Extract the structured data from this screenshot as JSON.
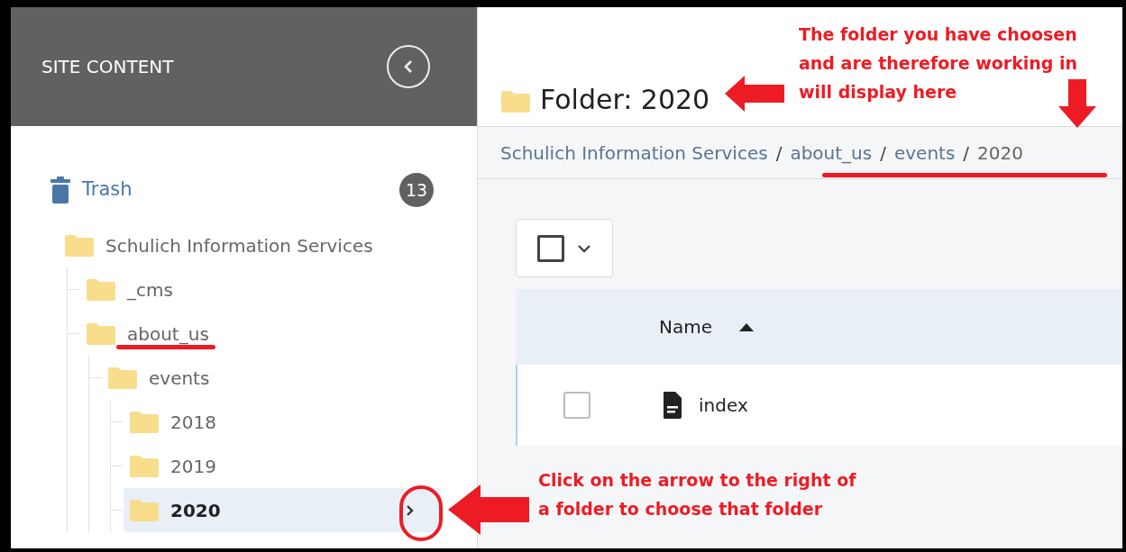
{
  "sidebar": {
    "title": "SITE CONTENT",
    "trash": {
      "label": "Trash",
      "count": "13"
    },
    "tree": [
      {
        "name": "Schulich Information Services",
        "selected": false,
        "children": [
          {
            "name": "_cms",
            "selected": false
          },
          {
            "name": "about_us",
            "selected": false,
            "children": [
              {
                "name": "events",
                "selected": false,
                "children": [
                  {
                    "name": "2018",
                    "selected": false
                  },
                  {
                    "name": "2019",
                    "selected": false
                  },
                  {
                    "name": "2020",
                    "selected": true
                  }
                ]
              }
            ]
          }
        ]
      }
    ]
  },
  "header": {
    "title": "Folder: 2020"
  },
  "breadcrumb": [
    {
      "kind": "link",
      "text": "Schulich Information Services"
    },
    {
      "kind": "separator",
      "text": "/"
    },
    {
      "kind": "link",
      "text": "about_us"
    },
    {
      "kind": "separator",
      "text": "/"
    },
    {
      "kind": "link",
      "text": "events"
    },
    {
      "kind": "separator",
      "text": "/"
    },
    {
      "kind": "current",
      "text": "2020"
    }
  ],
  "table": {
    "select_all": {
      "checked": false
    },
    "columns": [
      {
        "label": "Name",
        "sort_ascending": true
      }
    ],
    "rows": [
      {
        "name": "index",
        "checked": false
      }
    ]
  },
  "annotations": [
    {
      "kind": "top",
      "lines": [
        "The folder you have choosen",
        "and are therefore working in",
        "will display here"
      ]
    },
    {
      "kind": "bottom",
      "lines": [
        "Click on the arrow to the right of",
        "a folder to choose that folder"
      ]
    }
  ]
}
